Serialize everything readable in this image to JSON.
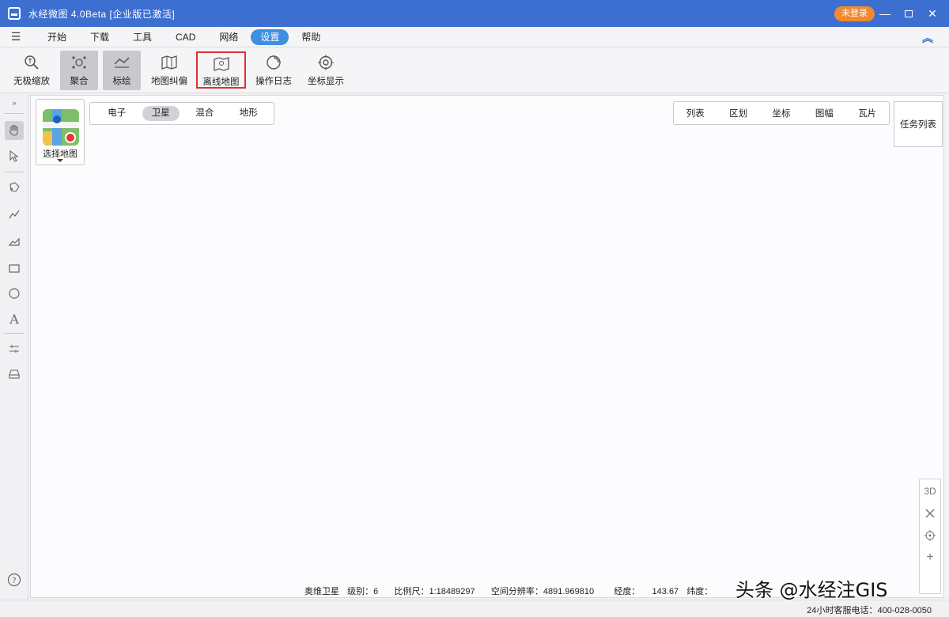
{
  "window": {
    "title": "水经微图 4.0Beta [企业版已激活]",
    "login_label": "未登录",
    "minimize": "—",
    "close": "✕"
  },
  "menu": {
    "items": [
      {
        "label": "开始"
      },
      {
        "label": "下载"
      },
      {
        "label": "工具"
      },
      {
        "label": "CAD"
      },
      {
        "label": "网络"
      },
      {
        "label": "设置",
        "active": true
      },
      {
        "label": "帮助"
      }
    ]
  },
  "ribbon": {
    "buttons": [
      {
        "label": "无极缩放",
        "icon": "zoom-icon"
      },
      {
        "label": "聚合",
        "icon": "cluster-icon",
        "state": "pressed"
      },
      {
        "label": "标绘",
        "icon": "draw-icon",
        "state": "pressed"
      },
      {
        "label": "地图纠偏",
        "icon": "map-correct-icon"
      },
      {
        "label": "离线地图",
        "icon": "offline-map-icon",
        "state": "highlighted"
      },
      {
        "label": "操作日志",
        "icon": "log-icon"
      },
      {
        "label": "坐标显示",
        "icon": "target-icon"
      }
    ]
  },
  "map": {
    "select_map_label": "选择地图",
    "map_types": [
      {
        "label": "电子"
      },
      {
        "label": "卫星",
        "active": true
      },
      {
        "label": "混合"
      },
      {
        "label": "地形"
      }
    ],
    "controls": [
      "列表",
      "区划",
      "坐标",
      "图幅",
      "瓦片"
    ],
    "task_list": "任务列表",
    "zoom_controls": {
      "dimension": "3D",
      "plus": "+"
    },
    "status": {
      "source": "奥维卫星",
      "level_label": "级别：",
      "level": "6",
      "scale_label": "比例尺：",
      "scale": "1:18489297",
      "resolution_label": "空间分辨率：",
      "resolution": "4891.969810",
      "longitude_label": "经度：",
      "longitude": "143.67",
      "latitude_label": "纬度："
    }
  },
  "footer": {
    "hotline": "24小时客服电话：400-028-0050"
  },
  "watermark": "头条 @水经注GIS",
  "colors": {
    "titlebar": "#3d6fd1",
    "active_tab": "#3f8fe0",
    "login_badge": "#f08a2c",
    "highlight_border": "#e03131"
  }
}
